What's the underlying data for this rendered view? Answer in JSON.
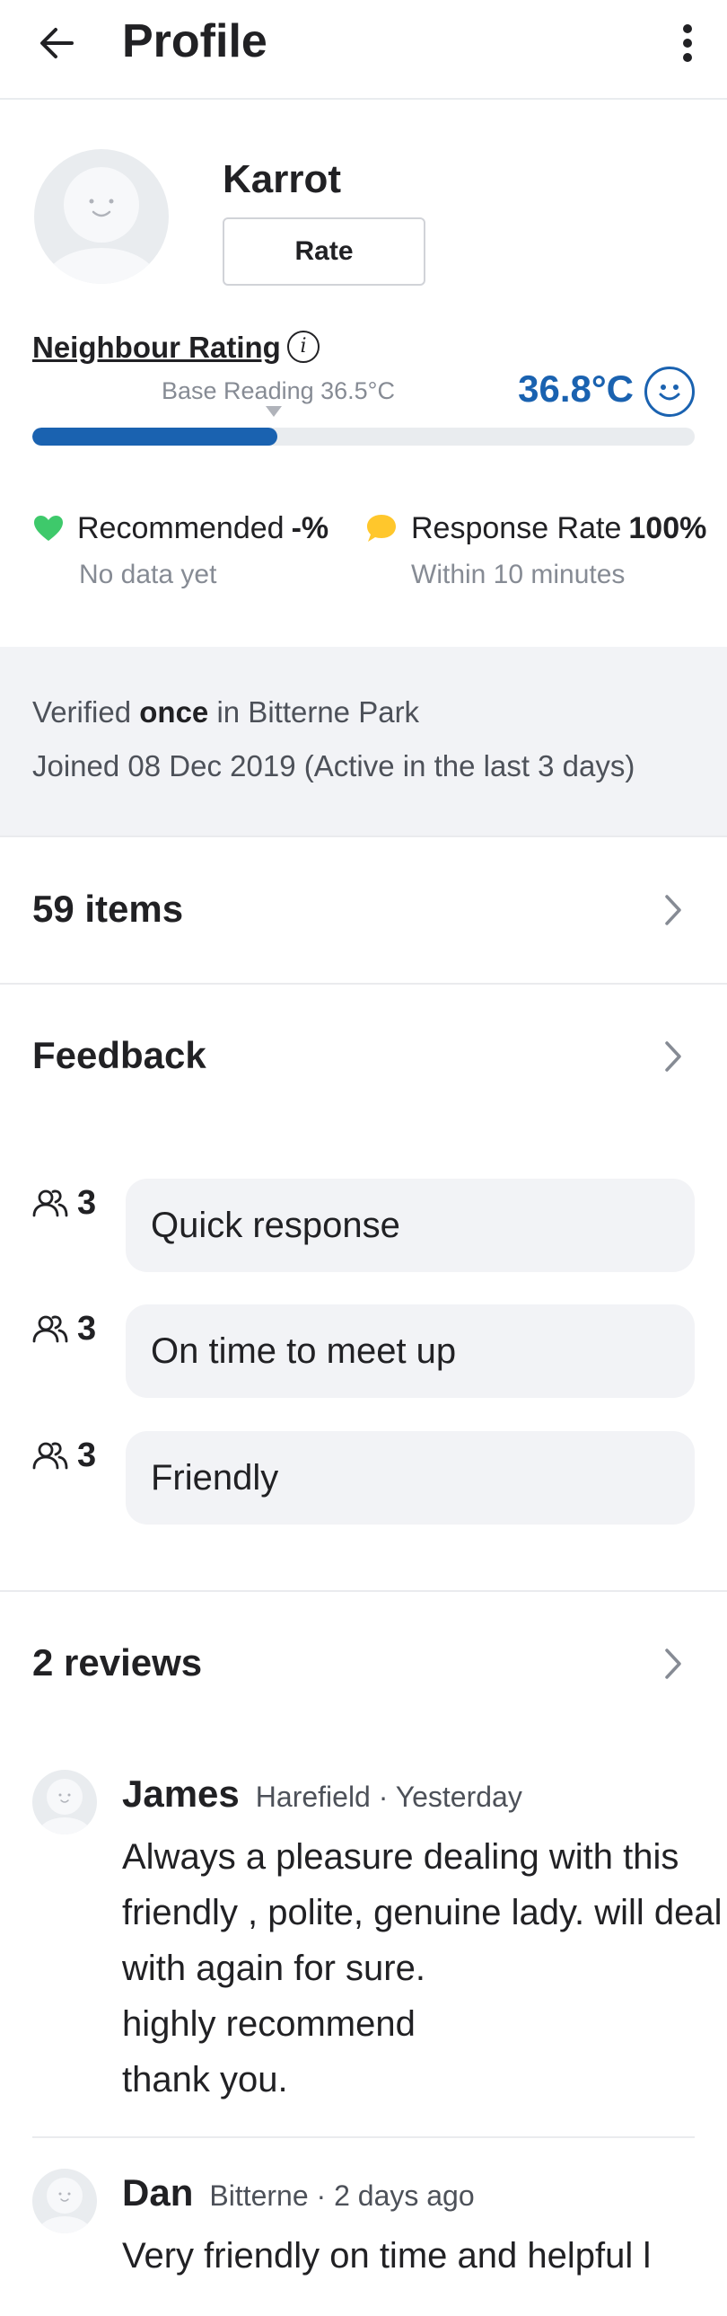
{
  "header": {
    "title": "Profile",
    "back_icon": "arrow-left-icon",
    "more_icon": "more-vertical-icon"
  },
  "profile": {
    "name": "Karrot",
    "rate_label": "Rate"
  },
  "neighbour_rating": {
    "label": "Neighbour Rating",
    "base_reading": "Base Reading 36.5°C",
    "temperature": "36.8°C",
    "progress_fraction": 0.37,
    "accent_color": "#1a62b0"
  },
  "stats": {
    "recommended": {
      "label": "Recommended",
      "value": "-%",
      "sub": "No data yet",
      "icon": "heart-icon",
      "icon_color": "#3ec96b"
    },
    "response_rate": {
      "label": "Response Rate",
      "value": "100%",
      "sub": "Within 10 minutes",
      "icon": "speech-bubble-icon",
      "icon_color": "#ffc72c"
    }
  },
  "verification": {
    "prefix": "Verified",
    "count": "once",
    "suffix": "in Bitterne Park",
    "joined": "Joined 08 Dec 2019 (Active in the last 3 days)"
  },
  "items": {
    "label": "59 items"
  },
  "feedback": {
    "title": "Feedback",
    "rows": [
      {
        "count": "3",
        "label": "Quick response"
      },
      {
        "count": "3",
        "label": "On time to meet up"
      },
      {
        "count": "3",
        "label": "Friendly"
      }
    ]
  },
  "reviews": {
    "title": "2 reviews",
    "list": [
      {
        "name": "James",
        "meta": "Harefield · Yesterday",
        "text": "Always a pleasure dealing with this friendly , polite, genuine lady. will deal with again for sure.\nhighly recommend\nthank you."
      },
      {
        "name": "Dan",
        "meta": "Bitterne · 2 days ago",
        "text": "Very friendly on time and helpful l"
      }
    ]
  }
}
